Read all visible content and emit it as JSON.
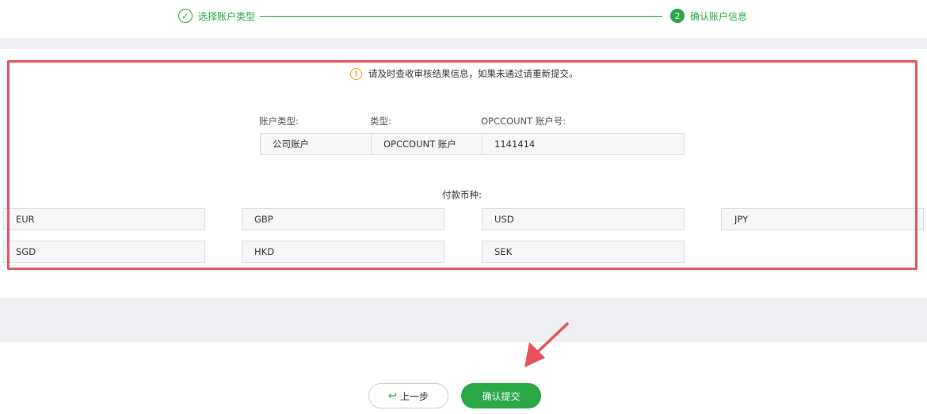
{
  "stepper": {
    "step1": {
      "label": "选择账户类型",
      "icon": "check-icon"
    },
    "step2": {
      "number": "2",
      "label": "确认账户信息"
    }
  },
  "notice": {
    "icon": "warning-icon",
    "text": "请及时查收审核结果信息，如果未通过请重新提交。"
  },
  "account": {
    "labels": {
      "account_type": "账户类型:",
      "type": "类型:",
      "opccount": "OPCCOUNT 账户号:"
    },
    "values": {
      "account_type": "公司账户",
      "type": "OPCCOUNT 账户",
      "opccount": "1141414"
    }
  },
  "currency": {
    "label": "付款币种:",
    "items": [
      "EUR",
      "GBP",
      "USD",
      "JPY",
      "SGD",
      "HKD",
      "SEK"
    ]
  },
  "buttons": {
    "prev": "上一步",
    "prev_icon": "back-arrow-icon",
    "submit": "确认提交"
  },
  "colors": {
    "accent": "#2aa846",
    "highlight": "#e9545c",
    "warning": "#f0a020"
  }
}
